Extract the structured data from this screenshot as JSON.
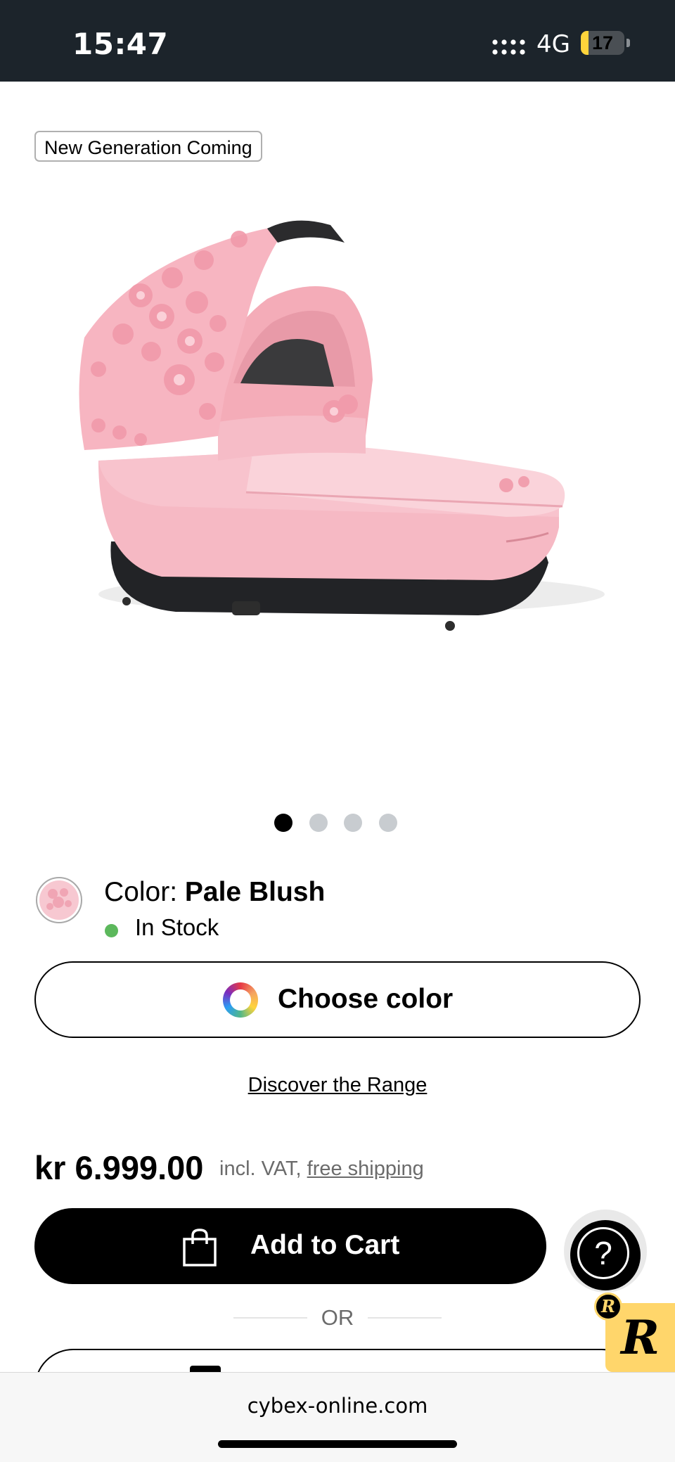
{
  "status_bar": {
    "time": "15:47",
    "network": "4G",
    "battery_level": "17",
    "battery_fraction": 0.17
  },
  "product": {
    "badge": "New Generation Coming",
    "image_icon": "pink-carrycot-image",
    "carousel": {
      "count": 4,
      "active_index": 0,
      "active_color": "#000000",
      "inactive_color": "#c8ccd0"
    },
    "color_label": "Color: ",
    "color_value": "Pale Blush",
    "stock_text": "In Stock",
    "stock_color": "#5cb85c",
    "choose_color_label": "Choose color",
    "discover_link": "Discover the Range",
    "price": "kr 6.999.00",
    "vat_text": "incl. VAT,",
    "shipping_link": "free shipping",
    "add_to_cart_label": "Add to Cart",
    "or_text": "OR"
  },
  "widgets": {
    "help_icon": "?",
    "review_badge": "R",
    "review_badge_small": "R",
    "accent": "#ffd66b"
  },
  "browser": {
    "url": "cybex-online.com"
  }
}
